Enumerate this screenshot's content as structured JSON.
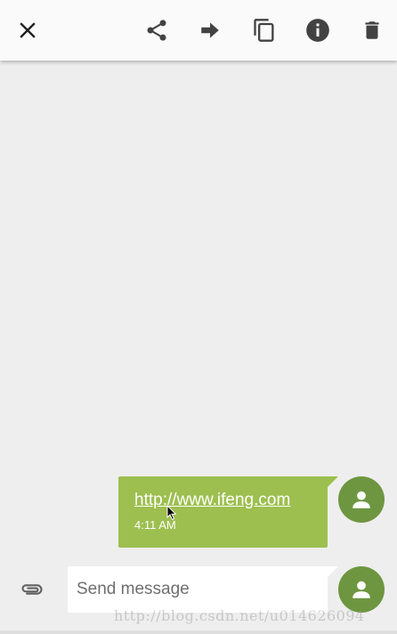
{
  "topbar": {
    "icons": [
      "close-icon",
      "share-icon",
      "forward-icon",
      "copy-icon",
      "info-icon",
      "delete-icon"
    ]
  },
  "conversation": {
    "messages": [
      {
        "text": "http://www.ifeng.com",
        "time": "4:11 AM",
        "bubble_color": "#9dbf4f",
        "avatar_color": "#6e9640"
      }
    ]
  },
  "compose": {
    "placeholder": "Send message",
    "value": ""
  },
  "watermark": {
    "text": "http://blog.csdn.net/u014626094"
  },
  "colors": {
    "background": "#eeeeee",
    "topbar": "#fafafa",
    "accent": "#9dbf4f",
    "avatar": "#6e9640",
    "icon": "#212121"
  }
}
